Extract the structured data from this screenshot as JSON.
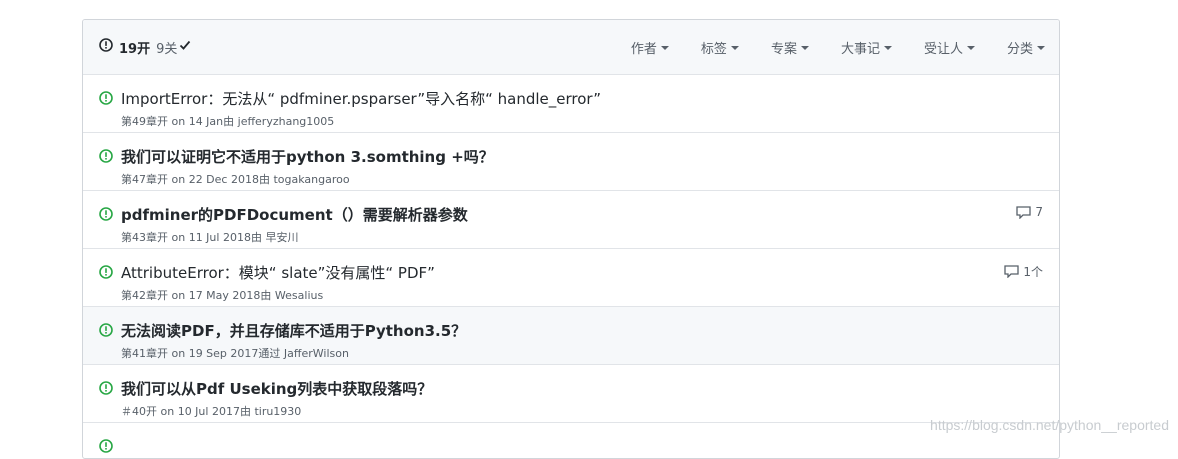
{
  "header": {
    "open_label": "19开",
    "closed_label": "9关",
    "filters": [
      "作者",
      "标签",
      "专案",
      "大事记",
      "受让人",
      "分类"
    ]
  },
  "issues": [
    {
      "title": "ImportError：无法从“ pdfminer.psparser”导入名称“ handle_error”",
      "meta": "第49章开 on 14 Jan由 jefferyzhang1005",
      "comments": ""
    },
    {
      "title": "我们可以证明它不适用于python 3.somthing +吗？",
      "meta": "第47章开 on 22 Dec 2018由 togakangaroo",
      "comments": ""
    },
    {
      "title": "pdfminer的PDFDocument（）需要解析器参数",
      "meta": "第43章开 on 11 Jul 2018由 早安川",
      "comments": "7"
    },
    {
      "title": "AttributeError：模块“ slate”没有属性“ PDF”",
      "meta": "第42章开 on 17 May 2018由 Wesalius",
      "comments": "1个"
    },
    {
      "title": "无法阅读PDF，并且存储库不适用于Python3.5？",
      "meta": "第41章开 on 19 Sep 2017通过 JafferWilson",
      "comments": ""
    },
    {
      "title": "我们可以从Pdf Useking列表中获取段落吗？",
      "meta": "＃40开 on 10 Jul 2017由 tiru1930",
      "comments": ""
    }
  ],
  "watermark": "https://blog.csdn.net/python__reported",
  "colors": {
    "open": "#28a745",
    "header_bg": "#f6f8fa",
    "border": "#d1d5da"
  }
}
